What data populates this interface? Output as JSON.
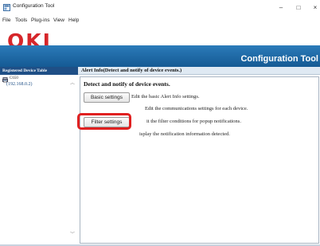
{
  "window": {
    "title": "Configuration Tool",
    "app_icon": "app-window-icon",
    "controls": {
      "minimize": "–",
      "maximize": "□",
      "close": "×"
    }
  },
  "menu": [
    "File",
    "Tools",
    "Plug-ins",
    "View",
    "Help"
  ],
  "header": {
    "logo": "OKI",
    "banner_title": "Configuration Tool",
    "brand_color": "#d6262a",
    "banner_color": "#1f6aa8"
  },
  "left_panel": {
    "title": "Registered Device Table",
    "devices": [
      {
        "name": "C650",
        "ip": "(192.168.0.2)",
        "icon": "printer-icon"
      }
    ]
  },
  "right_panel": {
    "title": "Alert Info(Detect and notify of device events.)",
    "content_title": "Detect and notify of device events.",
    "actions": [
      {
        "button": "Basic settings",
        "description": "Edit the basic Alert Info settings."
      },
      {
        "button": "",
        "description": "Edit the communications settings for each device."
      },
      {
        "button": "Filter settings",
        "description": "it the filter conditions for popup notifications."
      },
      {
        "button": "",
        "description": "isplay the notification information detected."
      }
    ],
    "highlight_color": "#e02020"
  }
}
